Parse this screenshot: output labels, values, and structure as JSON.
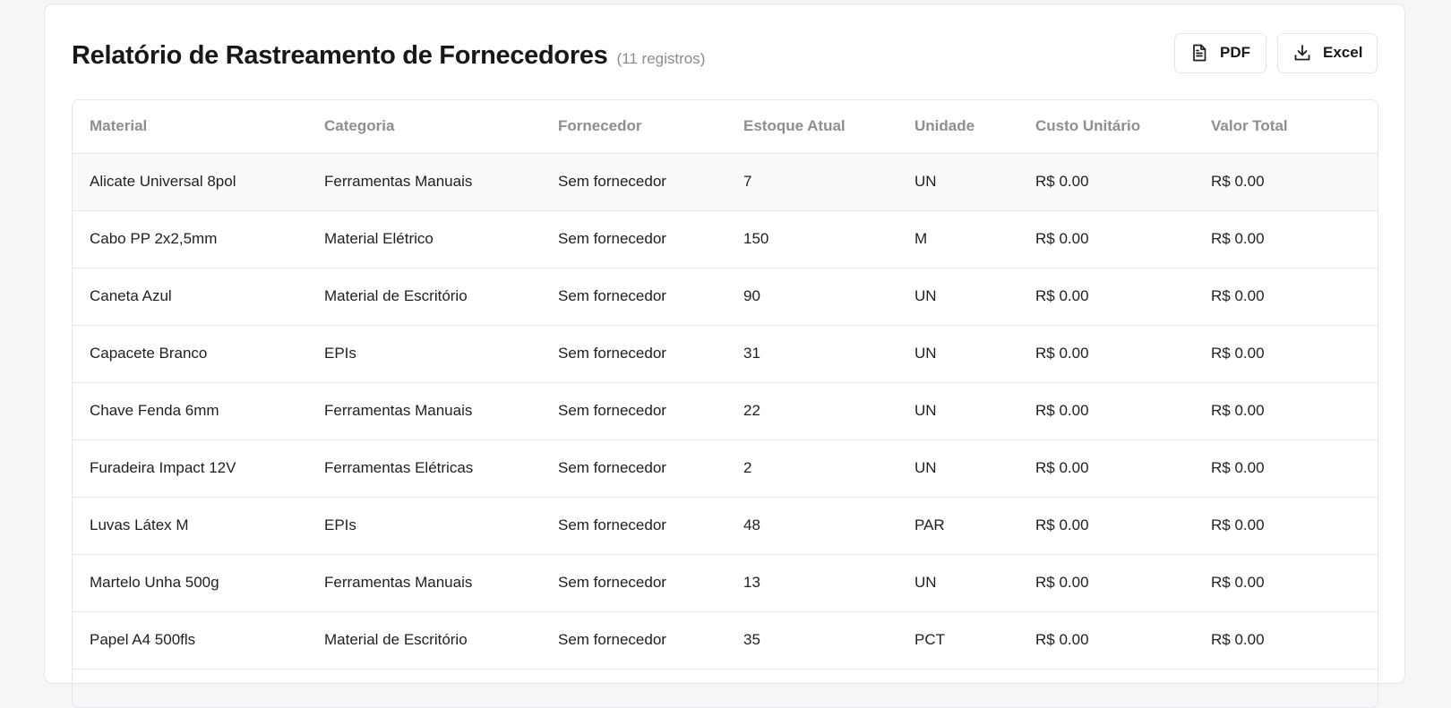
{
  "report": {
    "title": "Relatório de Rastreamento de Fornecedores",
    "count_label": "(11 registros)"
  },
  "actions": {
    "pdf": {
      "label": "PDF",
      "icon": "file-text-icon"
    },
    "excel": {
      "label": "Excel",
      "icon": "download-icon"
    }
  },
  "table": {
    "columns": [
      "Material",
      "Categoria",
      "Fornecedor",
      "Estoque Atual",
      "Unidade",
      "Custo Unitário",
      "Valor Total"
    ],
    "rows": [
      [
        "Alicate Universal 8pol",
        "Ferramentas Manuais",
        "Sem fornecedor",
        "7",
        "UN",
        "R$ 0.00",
        "R$ 0.00"
      ],
      [
        "Cabo PP 2x2,5mm",
        "Material Elétrico",
        "Sem fornecedor",
        "150",
        "M",
        "R$ 0.00",
        "R$ 0.00"
      ],
      [
        "Caneta Azul",
        "Material de Escritório",
        "Sem fornecedor",
        "90",
        "UN",
        "R$ 0.00",
        "R$ 0.00"
      ],
      [
        "Capacete Branco",
        "EPIs",
        "Sem fornecedor",
        "31",
        "UN",
        "R$ 0.00",
        "R$ 0.00"
      ],
      [
        "Chave Fenda 6mm",
        "Ferramentas Manuais",
        "Sem fornecedor",
        "22",
        "UN",
        "R$ 0.00",
        "R$ 0.00"
      ],
      [
        "Furadeira Impact 12V",
        "Ferramentas Elétricas",
        "Sem fornecedor",
        "2",
        "UN",
        "R$ 0.00",
        "R$ 0.00"
      ],
      [
        "Luvas Látex M",
        "EPIs",
        "Sem fornecedor",
        "48",
        "PAR",
        "R$ 0.00",
        "R$ 0.00"
      ],
      [
        "Martelo Unha 500g",
        "Ferramentas Manuais",
        "Sem fornecedor",
        "13",
        "UN",
        "R$ 0.00",
        "R$ 0.00"
      ],
      [
        "Papel A4 500fls",
        "Material de Escritório",
        "Sem fornecedor",
        "35",
        "PCT",
        "R$ 0.00",
        "R$ 0.00"
      ]
    ]
  },
  "colors": {
    "page_bg": "#f6f6f7",
    "card_bg": "#ffffff",
    "border": "#e5e6ea",
    "header_text": "#8d8d95",
    "body_text": "#1f1f23",
    "first_row_bg": "#fafafa"
  }
}
